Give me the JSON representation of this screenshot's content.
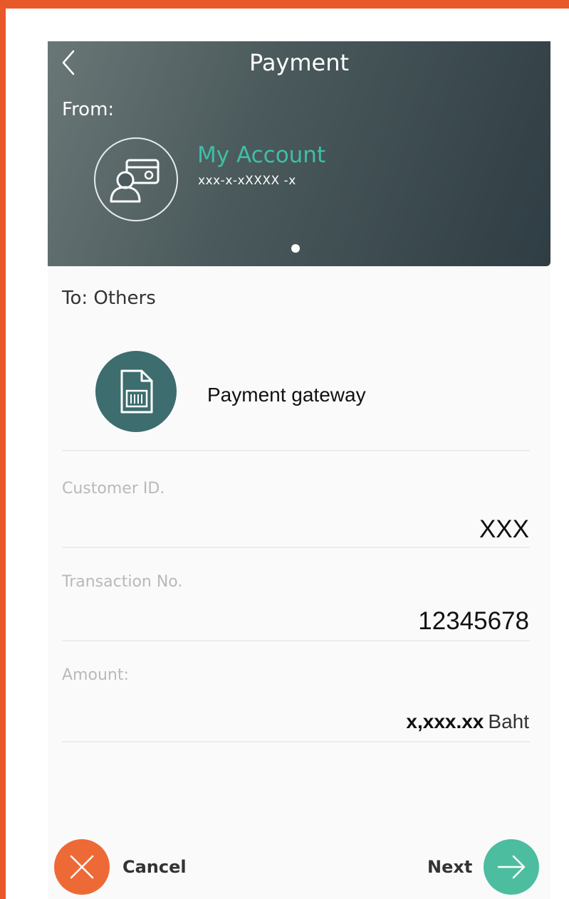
{
  "header": {
    "title": "Payment",
    "from_label": "From:",
    "account_name": "My Account",
    "account_number": "xxx-x-xXXXX -x"
  },
  "to": {
    "label": "To: Others",
    "biller_name": "Payment gateway"
  },
  "fields": {
    "customer_id": {
      "label": "Customer ID.",
      "value": "XXX"
    },
    "transaction_no": {
      "label": "Transaction No.",
      "value": "12345678"
    },
    "amount": {
      "label": "Amount:",
      "value": "x,xxx.xx",
      "unit": "Baht"
    }
  },
  "actions": {
    "cancel_label": "Cancel",
    "next_label": "Next"
  },
  "colors": {
    "frame": "#e8592a",
    "accent_teal": "#3ebfa6",
    "cancel": "#ed6a36",
    "next": "#4dbd9f",
    "biller_icon_bg": "#3d6d6e"
  },
  "icons": {
    "back": "chevron-left-icon",
    "account": "user-card-icon",
    "biller": "barcode-document-icon",
    "cancel": "close-icon",
    "next": "arrow-right-icon"
  }
}
